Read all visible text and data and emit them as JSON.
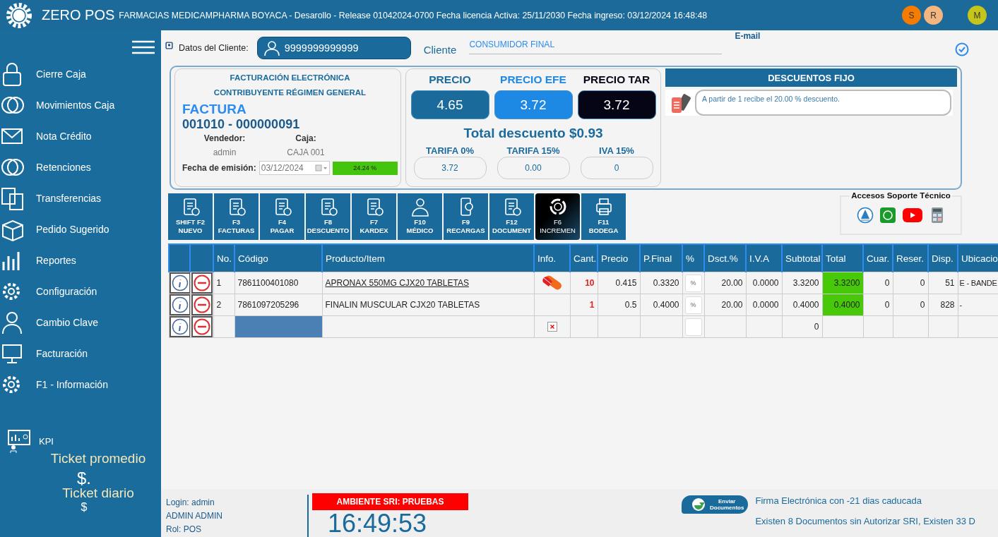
{
  "header": {
    "app_name": "ZERO POS",
    "info": "FARMACIAS MEDICAMPHARMA BOYACA - Desarollo - Release 01042024-0700 Fecha licencia Activa: 25/11/2030 Fecha ingreso: 03/12/2024 16:48:48",
    "avatars": [
      {
        "initial": "S",
        "color": "#f57c00"
      },
      {
        "initial": "R",
        "color": "#f4b57e"
      },
      {
        "initial": "M",
        "color": "#c5c51a"
      }
    ]
  },
  "sidebar": {
    "items": [
      {
        "label": "Cierre Caja"
      },
      {
        "label": "Movimientos Caja"
      },
      {
        "label": "Nota Crédito"
      },
      {
        "label": "Retenciones"
      },
      {
        "label": "Transferencias"
      },
      {
        "label": "Pedido Sugerido"
      },
      {
        "label": "Reportes"
      },
      {
        "label": "Configuración"
      },
      {
        "label": "Cambio Clave"
      },
      {
        "label": "Facturación"
      },
      {
        "label": "F1 - Información"
      }
    ],
    "kpi": {
      "label": "KPI",
      "ticket_promedio": "Ticket promedio",
      "promedio_value": "$.",
      "ticket_diario": "Ticket diario",
      "diario_value": "$"
    }
  },
  "client": {
    "label": "Datos del Cliente:",
    "id": "9999999999999",
    "cliente_label": "Cliente",
    "cliente_value": "CONSUMIDOR FINAL",
    "email_label": "E-mail"
  },
  "invoice": {
    "line1": "FACTURACIÓN ELECTRÓNICA",
    "line2": "CONTRIBUYENTE RÉGIMEN GENERAL",
    "type": "FACTURA",
    "number": "001010 - 000000091",
    "vendedor_label": "Vendedor:",
    "vendedor": "admin",
    "caja_label": "Caja:",
    "caja": "CAJA 001",
    "fecha_label": "Fecha de emisión:",
    "fecha": "03/12/2024",
    "percent": "24.24 %"
  },
  "prices": [
    {
      "title": "PRECIO",
      "value": "4.65",
      "color": "#1a6a9c"
    },
    {
      "title": "PRECIO EFE",
      "value": "3.72",
      "color": "#1e88e5"
    },
    {
      "title": "PRECIO TAR",
      "value": "3.72",
      "color": "#050516"
    }
  ],
  "total_descuento": "Total descuento $0.93",
  "tarifas": [
    {
      "label": "TARIFA 0%",
      "value": "3.72"
    },
    {
      "label": "TARIFA 15%",
      "value": "0.00"
    },
    {
      "label": "IVA 15%",
      "value": "0"
    }
  ],
  "descuentos": {
    "title": "DESCUENTOS FIJO",
    "items": [
      "A partir de 1 recibe el 20.00 % descuento."
    ]
  },
  "function_buttons": [
    {
      "lines": [
        "SHIFT F2",
        "NUEVO"
      ],
      "selected": false
    },
    {
      "lines": [
        "F3",
        "FACTURAS"
      ],
      "selected": false
    },
    {
      "lines": [
        "F4",
        "PAGAR"
      ],
      "selected": false
    },
    {
      "lines": [
        "F8",
        "DESCUENTO"
      ],
      "selected": false
    },
    {
      "lines": [
        "F7",
        "KARDEX"
      ],
      "selected": false
    },
    {
      "lines": [
        "F10",
        "MÉDICO"
      ],
      "selected": false
    },
    {
      "lines": [
        "F9",
        "RECARGAS"
      ],
      "selected": false
    },
    {
      "lines": [
        "F12",
        "DOCUMENT"
      ],
      "selected": false
    },
    {
      "lines": [
        "F6",
        "INCREMEN"
      ],
      "selected": true
    },
    {
      "lines": [
        "F11",
        "BODEGA"
      ],
      "selected": false
    }
  ],
  "soporte": {
    "title": "Accesos Soporte Técnico"
  },
  "table": {
    "columns": [
      "No.",
      "Código",
      "Producto/Item",
      "Info.",
      "Cant.",
      "Precio",
      "P.Final",
      "%",
      "Dsct.%",
      "I.V.A",
      "Subtotal",
      "Total",
      "Cuar.",
      "Reser.",
      "Disp.",
      "Ubicacio"
    ],
    "rows": [
      {
        "kind": "item",
        "no": "1",
        "codigo": "7861100401080",
        "producto": "APRONAX 550MG CJX20 TABLETAS",
        "linked": true,
        "info": true,
        "cant": "10",
        "precio": "0.415",
        "pfinal": "0.3320",
        "pct": "%",
        "dsct": "20.00",
        "iva": "0.0000",
        "subtotal": "3.3200",
        "total": "3.3200",
        "cuar": "0",
        "reser": "0",
        "disp": "51",
        "ubicacion": "E - BANDE"
      },
      {
        "kind": "item",
        "no": "2",
        "codigo": "7861097205296",
        "producto": "FINALIN MUSCULAR CJX20 TABLETAS",
        "linked": false,
        "info": false,
        "cant": "1",
        "precio": "0.5",
        "pfinal": "0.4000",
        "pct": "%",
        "dsct": "20.00",
        "iva": "0.0000",
        "subtotal": "0.4000",
        "total": "0.4000",
        "cuar": "0",
        "reser": "0",
        "disp": "828",
        "ubicacion": "-"
      },
      {
        "kind": "new",
        "subtotal": "0"
      }
    ]
  },
  "footer": {
    "login": "Login:  admin",
    "user": "ADMIN ADMIN",
    "rol": "Rol:   POS",
    "ambiente": "AMBIENTE SRI: PRUEBAS",
    "clock": "16:49:53",
    "enviar": [
      "Enviar",
      "Documentos"
    ],
    "messages": [
      "Firma Electrónica con -21 dias caducada",
      "Existen 8 Documentos sin Autorizar SRI, Existen 33 D"
    ]
  }
}
